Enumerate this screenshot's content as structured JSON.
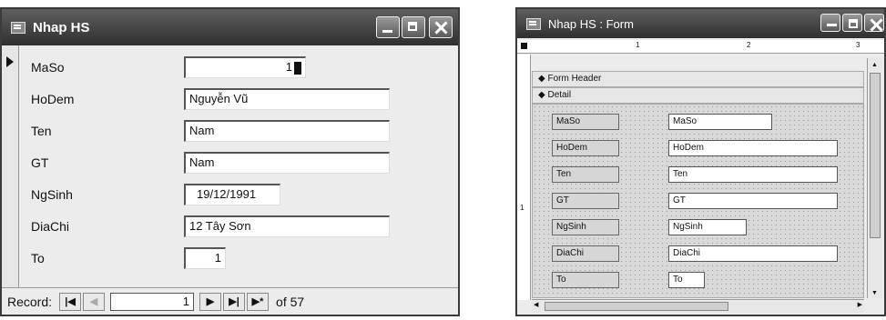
{
  "left_form": {
    "title": "Nhap HS",
    "fields": [
      {
        "label": "MaSo",
        "value": "1"
      },
      {
        "label": "HoDem",
        "value": "Nguyễn Vũ"
      },
      {
        "label": "Ten",
        "value": "Nam"
      },
      {
        "label": "GT",
        "value": "Nam"
      },
      {
        "label": "NgSinh",
        "value": "19/12/1991"
      },
      {
        "label": "DiaChi",
        "value": "12 Tây Sơn"
      },
      {
        "label": "To",
        "value": "1"
      }
    ],
    "navigation": {
      "record_label": "Record:",
      "current_record": "1",
      "total_text": "of 57",
      "first_icon": "first-record-icon",
      "prev_icon": "previous-record-icon",
      "next_icon": "next-record-icon",
      "last_icon": "last-record-icon",
      "new_icon": "new-record-icon"
    }
  },
  "right_form": {
    "title": "Nhap HS : Form",
    "ruler_marks": [
      "1",
      "2",
      "3"
    ],
    "vruler_mark": "1",
    "sections": {
      "header": "Form Header",
      "detail": "Detail"
    },
    "rows": [
      {
        "label": "MaSo",
        "control": "MaSo"
      },
      {
        "label": "HoDem",
        "control": "HoDem"
      },
      {
        "label": "Ten",
        "control": "Ten"
      },
      {
        "label": "GT",
        "control": "GT"
      },
      {
        "label": "NgSinh",
        "control": "NgSinh"
      },
      {
        "label": "DiaChi",
        "control": "DiaChi"
      },
      {
        "label": "To",
        "control": "To"
      }
    ]
  }
}
